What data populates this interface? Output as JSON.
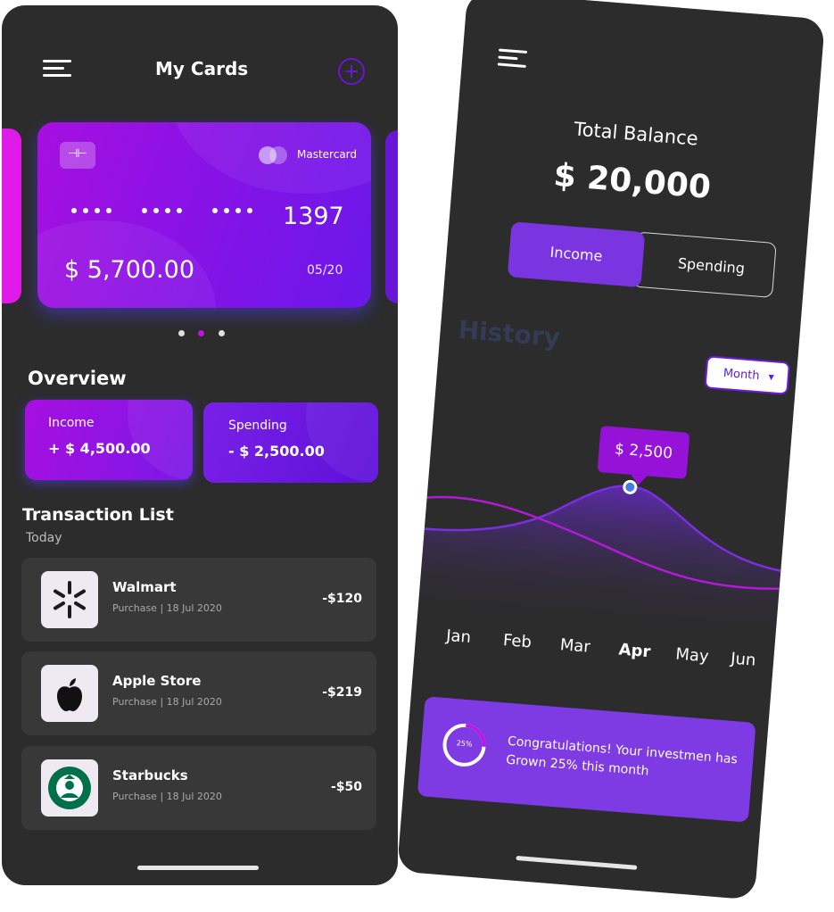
{
  "left_screen": {
    "header": {
      "title": "My Cards",
      "menu_icon": "hamburger-menu-icon",
      "add_icon": "plus-circle-icon"
    },
    "card": {
      "brand": "Mastercard",
      "masked_group": "••••",
      "last4": "1397",
      "balance": "$ 5,700.00",
      "expiry": "05/20"
    },
    "pager": {
      "count": 3,
      "active_index": 1
    },
    "overview": {
      "title": "Overview",
      "income": {
        "label": "Income",
        "value": "+ $ 4,500.00"
      },
      "spending": {
        "label": "Spending",
        "value": "- $ 2,500.00"
      }
    },
    "transactions": {
      "title": "Transaction List",
      "subtitle": "Today",
      "items": [
        {
          "name": "Walmart",
          "meta": "Purchase | 18 Jul 2020",
          "amount": "-$120",
          "icon": "walmart-logo-icon"
        },
        {
          "name": "Apple Store",
          "meta": "Purchase | 18 Jul 2020",
          "amount": "-$219",
          "icon": "apple-logo-icon"
        },
        {
          "name": "Starbucks",
          "meta": "Purchase | 18 Jul 2020",
          "amount": "-$50",
          "icon": "starbucks-logo-icon"
        }
      ]
    }
  },
  "right_screen": {
    "menu_icon": "hamburger-menu-icon",
    "total_balance_label": "Total Balance",
    "total_balance_value": "$ 20,000",
    "segment": {
      "income": "Income",
      "spending": "Spending",
      "active": "income"
    },
    "history_label": "History",
    "period_select": "Month",
    "tooltip_value": "$ 2,500",
    "months": [
      "Jan",
      "Feb",
      "Mar",
      "Apr",
      "May",
      "Jun"
    ],
    "active_month": "Apr",
    "congrats": {
      "progress_label": "25%",
      "progress": 0.25,
      "message": "Congratulations! Your investmen has Grown 25% this month"
    }
  },
  "colors": {
    "phone_bg": "#2c2c2d",
    "accent_purple": "#7a34e0",
    "card_gradient_start": "#a70fe0",
    "card_gradient_end": "#6a18ea",
    "chart_point": "#3f7fe0",
    "row_bg": "#383839"
  }
}
